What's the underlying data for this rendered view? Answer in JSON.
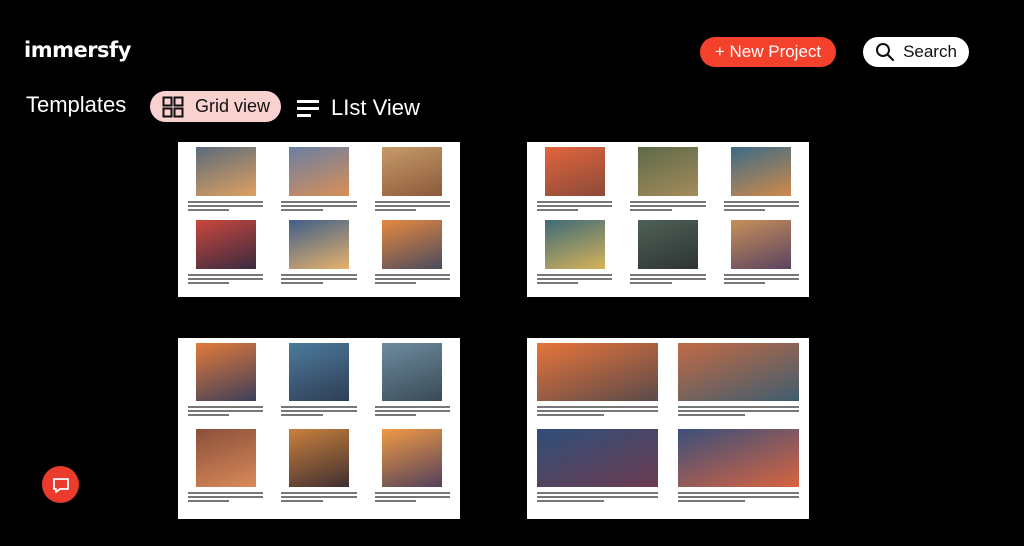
{
  "header": {
    "logo_text": "immersfy",
    "new_project_label": "+ New Project",
    "search_label": "Search"
  },
  "toolbar": {
    "templates_label": "Templates",
    "grid_view_label": "Grid view",
    "list_view_label": "LIst View"
  },
  "icons": {
    "search": "search-icon",
    "grid": "grid-icon",
    "list": "list-icon",
    "chat": "chat-icon"
  },
  "colors": {
    "accent": "#f4412c",
    "grid_view_bg": "#f9d2d0",
    "page_bg": "#000000"
  },
  "templates": [
    {
      "name": "template-1",
      "layout": "3x2",
      "images": [
        [
          "#5b6b7c",
          "#e0a060"
        ],
        [
          "#6a7fa3",
          "#d98f57"
        ],
        [
          "#c89a6a",
          "#8b5a3a"
        ],
        [
          "#c9473d",
          "#3a2a3f"
        ],
        [
          "#3f5e8a",
          "#e7b26b"
        ],
        [
          "#e7893f",
          "#4b4a5d"
        ]
      ]
    },
    {
      "name": "template-2",
      "layout": "3x2",
      "images": [
        [
          "#e3653c",
          "#8a4a3a"
        ],
        [
          "#5d6a48",
          "#a58b5c"
        ],
        [
          "#3b6b87",
          "#d08a4a"
        ],
        [
          "#3d6a77",
          "#d6b35a"
        ],
        [
          "#4f6158",
          "#2d3432"
        ],
        [
          "#c78f5a",
          "#5a4360"
        ]
      ]
    },
    {
      "name": "template-3",
      "layout": "3x2",
      "images": [
        [
          "#e27a3a",
          "#3d3f5a"
        ],
        [
          "#4c7a9c",
          "#2f3e55"
        ],
        [
          "#6d8ca0",
          "#3a4a55"
        ],
        [
          "#8a4f3a",
          "#d98a5a"
        ],
        [
          "#c9803e",
          "#3f2f2f"
        ],
        [
          "#f09a45",
          "#52405a"
        ]
      ]
    },
    {
      "name": "template-4",
      "layout": "2x2",
      "images": [
        [
          "#e6743a",
          "#5a4a4a"
        ],
        [
          "#c26a45",
          "#3f5d6e"
        ],
        [
          "#2f4f7a",
          "#6b3a4f"
        ],
        [
          "#3a4f7a",
          "#d86440"
        ]
      ]
    }
  ]
}
